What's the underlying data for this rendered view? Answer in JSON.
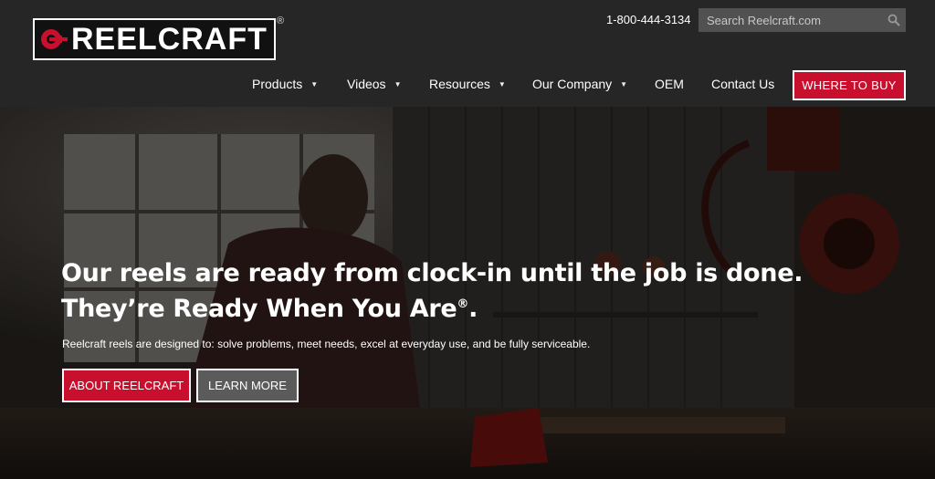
{
  "brand": {
    "name": "REELCRAFT",
    "registered": "®"
  },
  "header": {
    "phone": "1-800-444-3134",
    "search_placeholder": "Search Reelcraft.com"
  },
  "nav": {
    "items": [
      {
        "label": "Products",
        "caret": "▼"
      },
      {
        "label": "Videos",
        "caret": "▼"
      },
      {
        "label": "Resources",
        "caret": "▼"
      },
      {
        "label": "Our Company",
        "caret": "▼"
      },
      {
        "label": "OEM"
      },
      {
        "label": "Contact Us"
      }
    ],
    "cta": "WHERE TO BUY"
  },
  "hero": {
    "headline_line1": "Our reels are ready from clock-in until the job is done.",
    "headline_line2": "They’re Ready When You Are",
    "headline_reg": "®",
    "headline_end": ".",
    "subtext": "Reelcraft reels are designed to: solve problems, meet needs, excel at everyday use, and be fully serviceable.",
    "buttons": {
      "about": "ABOUT REELCRAFT",
      "learn": "LEARN MORE"
    }
  },
  "colors": {
    "brand_red": "#c8102e",
    "header_bg": "#262626",
    "search_bg": "#515151"
  },
  "icons": {
    "search": "search-icon",
    "caret": "caret-down-icon",
    "logo": "reel-logo-icon"
  }
}
